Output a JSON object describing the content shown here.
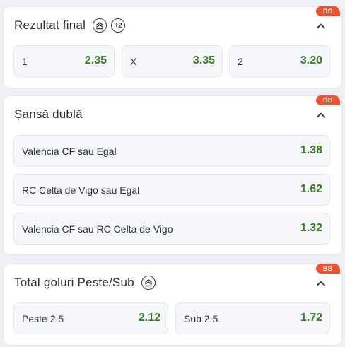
{
  "colors": {
    "odds_green": "#3a7d1e",
    "badge_orange": "#f2512d",
    "background": "#eef0f5"
  },
  "markets": [
    {
      "title": "Rezultat final",
      "badge": "BB",
      "icons": [
        "bet-builder-icon",
        "plus-two-icon"
      ],
      "plus_icon_text": "+2",
      "outcomes": [
        {
          "label": "1",
          "odds": "2.35"
        },
        {
          "label": "X",
          "odds": "3.35"
        },
        {
          "label": "2",
          "odds": "3.20"
        }
      ]
    },
    {
      "title": "Șansă dublă",
      "badge": "BB",
      "icons": [],
      "outcomes": [
        {
          "label": "Valencia CF sau Egal",
          "odds": "1.38"
        },
        {
          "label": "RC Celta de Vigo sau Egal",
          "odds": "1.62"
        },
        {
          "label": "Valencia CF sau RC Celta de Vigo",
          "odds": "1.32"
        }
      ]
    },
    {
      "title": "Total goluri Peste/Sub",
      "badge": "BB",
      "icons": [
        "bet-builder-icon"
      ],
      "outcomes": [
        {
          "label": "Peste 2.5",
          "odds": "2.12"
        },
        {
          "label": "Sub 2.5",
          "odds": "1.72"
        }
      ]
    }
  ]
}
